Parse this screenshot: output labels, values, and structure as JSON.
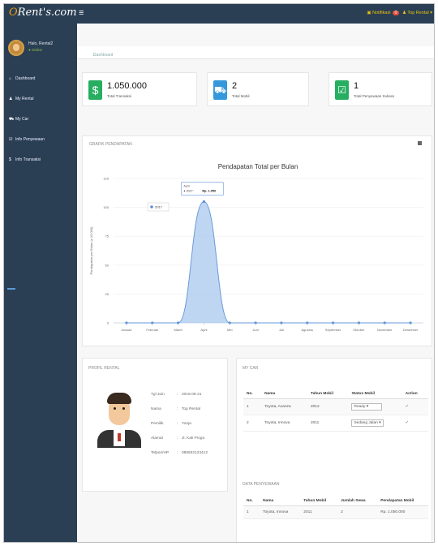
{
  "app": {
    "brand": "ORent's.com",
    "brand_first": "O",
    "brand_rest": "Rent's.com"
  },
  "topbar": {
    "notifications_label": "Notifikasi",
    "notifications_count": "0",
    "user_label": "Top Rental"
  },
  "sidebar": {
    "greeting": "Halo, Rental2",
    "role": "Online",
    "items": [
      {
        "label": "Dashboard",
        "icon": "home-icon"
      },
      {
        "label": "My Rental",
        "icon": "user-icon"
      },
      {
        "label": "My Car",
        "icon": "car-icon"
      },
      {
        "label": "Info Penyewaan",
        "icon": "check-icon"
      },
      {
        "label": "Info Transaksi",
        "icon": "dollar-icon"
      }
    ]
  },
  "breadcrumb": "Dashboard",
  "stats": [
    {
      "icon": "$",
      "value": "1.050.000",
      "label": "Total Transaksi",
      "color": "#27ae60"
    },
    {
      "icon": "car",
      "value": "2",
      "label": "Total Mobil",
      "color": "#3498db"
    },
    {
      "icon": "check",
      "value": "1",
      "label": "Total Penyewaan Sukses",
      "color": "#27ae60"
    }
  ],
  "chart_section_title": "GRAFIK PENDAPATAN",
  "chart_data": {
    "type": "area",
    "title": "Pendapatan Total per Bulan",
    "ylabel": "Pendapatan per Bulan (x 10.000)",
    "categories": [
      "Januari",
      "Februari",
      "Maret",
      "April",
      "Mei",
      "Juni",
      "Juli",
      "Agustus",
      "September",
      "Oktober",
      "November",
      "Desember"
    ],
    "series": [
      {
        "name": "2017",
        "values": [
          0,
          0,
          0,
          105,
          0,
          0,
          0,
          0,
          0,
          0,
          0,
          0
        ]
      }
    ],
    "yticks": [
      0,
      25,
      50,
      75,
      100,
      125
    ],
    "ylim": [
      0,
      125
    ],
    "tooltip": {
      "title": "April",
      "series": "2017",
      "value": "Rp. 1.050"
    },
    "color": "#a9c8ee",
    "legend": "top-left"
  },
  "profile": {
    "title": "PROFIL RENTAL",
    "rows": [
      {
        "key": "Tgl Join",
        "value": "2015-09-21"
      },
      {
        "key": "Nama",
        "value": "Top Rental"
      },
      {
        "key": "Pemilik",
        "value": "Yonja"
      },
      {
        "key": "Alamat",
        "value": "Jl. Kali Progo"
      },
      {
        "key": "Telpon/HP",
        "value": "085632123412"
      }
    ]
  },
  "my_car": {
    "title": "MY CAR",
    "headers": [
      "No.",
      "Nama",
      "Tahun Mobil",
      "Status Mobil",
      "Action"
    ],
    "rows": [
      {
        "no": "1",
        "nama": "Toyota, Avanza",
        "tahun": "2012",
        "status": "Ready",
        "action": "✓"
      },
      {
        "no": "2",
        "nama": "Toyota, Innova",
        "tahun": "2011",
        "status": "Sedang Jalan",
        "action": "✓"
      }
    ]
  },
  "penyewaan": {
    "title": "DATA PENYEWAAN",
    "headers": [
      "No.",
      "Nama",
      "Tahun Mobil",
      "Jumlah Sewa",
      "Pendapatan Mobil"
    ],
    "rows": [
      {
        "no": "1",
        "nama": "Toyota, Innova",
        "tahun": "2011",
        "jumlah": "2",
        "pendapatan": "Rp. 1.050.000"
      }
    ]
  }
}
